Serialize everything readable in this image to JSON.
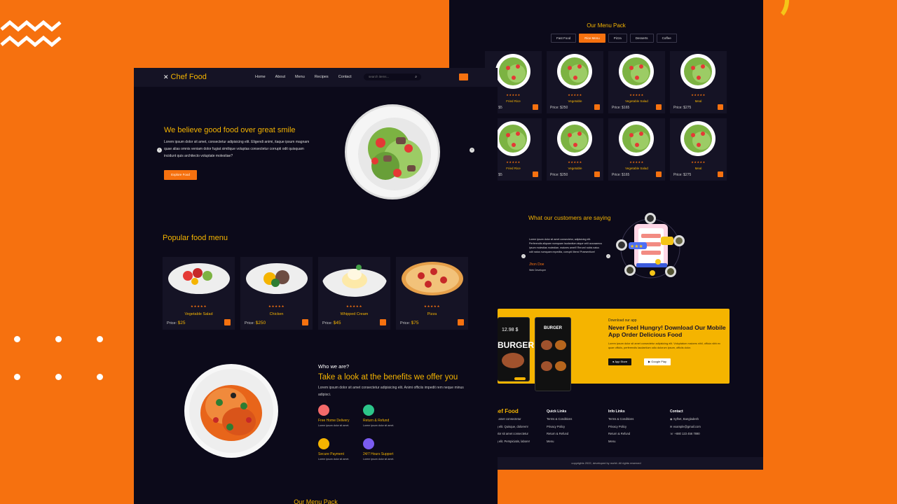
{
  "brand": {
    "name": "Chef Food"
  },
  "nav": {
    "items": [
      "Home",
      "About",
      "Menu",
      "Recipes",
      "Contact"
    ],
    "search_placeholder": "search items..."
  },
  "hero": {
    "title": "We believe good food over great smile",
    "text": "Lorem ipsum dolor sit amet, consectetur adipisicing elit. Eligendi animi, itaque ipsum magnam quae alias omnis veniam dolor fugiat similique voluptas consectetur corrupti odit quisquam incidunt quis architecto voluptate molestiae?",
    "button": "Explore Food"
  },
  "popular": {
    "title": "Popular food menu",
    "price_label": "Price:",
    "stars": "★★★★★",
    "items": [
      {
        "name": "Vegetable Salad",
        "price": "$25"
      },
      {
        "name": "Chicken",
        "price": "$250"
      },
      {
        "name": "Whipped Cream",
        "price": "$45"
      },
      {
        "name": "Pizza",
        "price": "$75"
      }
    ]
  },
  "about": {
    "eyebrow": "Who we are?",
    "title": "Take a look at the benefits we offer you",
    "text": "Lorem ipsum dolor sit amet consectetur adipisicing elit. Animi officiis impedit rem neque minus adipisci.",
    "features": [
      {
        "title": "Free Home Delivery",
        "desc": "Lorem ipsum dolor sit amet.",
        "color": "#f46a6a"
      },
      {
        "title": "Return & Refund",
        "desc": "Lorem ipsum dolor sit amet.",
        "color": "#2cc58a"
      },
      {
        "title": "Secure Payment",
        "desc": "Lorem ipsum dolor sit amet.",
        "color": "#f5b400"
      },
      {
        "title": "24/7 Hours Support",
        "desc": "Lorem ipsum dolor sit amet.",
        "color": "#7b5cf0"
      }
    ]
  },
  "bottom_title": "Our Menu Pack",
  "menu_pack": {
    "title": "Our Menu Pack",
    "tabs": [
      "Fast Food",
      "Rice Menu",
      "Pizza",
      "Desserts",
      "Coffee"
    ],
    "active_tab": "Rice Menu",
    "stars": "★★★★★",
    "price_label": "Price:",
    "items": [
      {
        "name": "Fried Rice",
        "price": "$5"
      },
      {
        "name": "Vegetable",
        "price": "$250"
      },
      {
        "name": "Vegetable Salad",
        "price": "$165"
      },
      {
        "name": "Meal",
        "price": "$275"
      },
      {
        "name": "Fried Rice",
        "price": "$5"
      },
      {
        "name": "Vegetable",
        "price": "$250"
      },
      {
        "name": "Vegetable Salad",
        "price": "$165"
      },
      {
        "name": "Meal",
        "price": "$275"
      }
    ]
  },
  "testimonial": {
    "title": "What our customers are saying",
    "quote": "Lorem ipsum dolor sit amet consectetur, adipisicing elit. Perferendis aliquam numquam laudantium atque velit accusamus ipsum molestias molestiae, maiores amet!! Rerum! nobis natus odit natus numquam expedita, corrupti libero! Praesentium!",
    "name": "Jhon Doe",
    "role": "Web Developer"
  },
  "app": {
    "eyebrow": "Download our app",
    "title": "Never Feel Hungry! Download Our Mobile App Order Delicious Food",
    "text": "Lorem ipsum dolor sit amet consectetur adipisicing elit. Voluptatum maiores nihil, officia nibh ex quae officiis, perferendis laudantium odio dolorum ipsum, officiis dolor.",
    "btn_appstore": "App Store",
    "btn_googleplay": "Google Play",
    "phone1_price": "12.98 $",
    "phone1_word": "BURGER",
    "phone2_word": "BURGER"
  },
  "footer": {
    "brand_partial": "hef Food",
    "brand_text": [
      "sit amet consectetur",
      "ng elit. Quisque, dolorem!",
      "dolor sit amet consectetur",
      "ng elit. Perspiciatis, labore!"
    ],
    "quick_title": "Quick Links",
    "quick_links": [
      "Terms & Conditions",
      "Privacy Policy",
      "Return & Refund",
      "Menu"
    ],
    "info_title": "Info Links",
    "info_links": [
      "Terms & Conditions",
      "Privacy Policy",
      "Return & Refund",
      "Menu"
    ],
    "contact_title": "Contact",
    "contact": [
      "Sylhet, Bangladesh",
      "example@gmail.com",
      "+880 123 456 7890"
    ],
    "copyright": "copyrights 2022, developed by mohit. All rights reserved"
  },
  "colors": {
    "accent": "#f6710f",
    "gold": "#f5b400",
    "bg": "#0c0a1a",
    "card": "#151325"
  }
}
